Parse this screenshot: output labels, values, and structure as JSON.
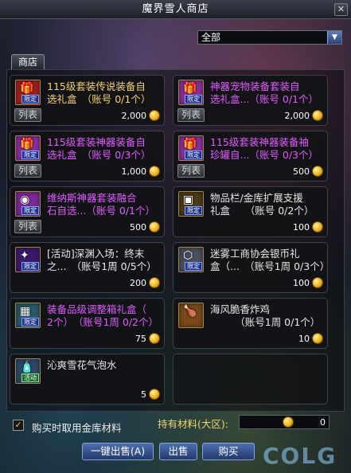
{
  "window": {
    "title": "魔界雪人商店",
    "close_glyph": "✕"
  },
  "category": {
    "selected": "全部",
    "dropdown_glyph": "▼"
  },
  "tab": {
    "label": "商店"
  },
  "items": [
    {
      "name": "115级套装传说装备自\n选礼盒　（账号 0/1个）",
      "price": "2,000",
      "list_label": "列表",
      "badge": "限定",
      "icon": "gift-box-icon",
      "icon_color": "#a0201e"
    },
    {
      "name": "神器宠物装备套装自\n选礼盒...（账号 0/1个）",
      "price": "2,000",
      "list_label": "列表",
      "badge": "限定",
      "icon": "gift-box-icon",
      "icon_color": "#8b2f9c"
    },
    {
      "name": "115级套装神器装备自\n选礼盒　（账号 0/3个）",
      "price": "1,000",
      "list_label": "列表",
      "badge": "限定",
      "icon": "gift-box-icon",
      "icon_color": "#8b2f9c"
    },
    {
      "name": "115级套装神器装备袖\n珍罐自...（账号 0/3个）",
      "price": "500",
      "list_label": "列表",
      "badge": "限定",
      "icon": "gift-box-icon",
      "icon_color": "#8b2f9c"
    },
    {
      "name": "维纳斯神器套装融合\n石自选...（账号 0/1个）",
      "price": "500",
      "list_label": "列表",
      "badge": "限定",
      "icon": "stone-icon",
      "icon_color": "#7a2a96"
    },
    {
      "name": "物品栏/金库扩展支援\n礼盒　　（账号 0/2个）",
      "price": "100",
      "badge": "限定",
      "icon": "chest-icon",
      "icon_color": "#4a3a1a"
    },
    {
      "name": "[活动]深渊入场：终末\n之...　（账号1周 0/5个）",
      "price": "200",
      "badge": "限定",
      "icon": "crystal-icon",
      "icon_color": "#3a1a6a"
    },
    {
      "name": "迷雾工商协会银币礼\n盒（...　（账号1周 0/3个）",
      "price": "100",
      "badge": "限定",
      "icon": "coin-box-icon",
      "icon_color": "#4a5060"
    },
    {
      "name": "装备品级调整箱礼盒（\n2个）　（账号1周 0/2个）",
      "price": "75",
      "badge": "限定",
      "icon": "box-icon",
      "icon_color": "#2a5a6a"
    },
    {
      "name": "海风脆香炸鸡\n　　　（账号1周 0/1个）",
      "price": "10",
      "badge": "",
      "icon": "food-icon",
      "icon_color": "#7a4a1a"
    },
    {
      "name": "沁爽雪花气泡水",
      "price": "5",
      "badge": "活动",
      "icon": "bottle-icon",
      "icon_color": "#2a4a6a"
    }
  ],
  "bottom": {
    "check_glyph": "✓",
    "use_vault_label": "购买时取用金库材料",
    "materials_label": "持有材料(大区):",
    "materials_value": "0"
  },
  "buttons": {
    "sell_all": "一键出售(A)",
    "sell": "出售",
    "buy": "购买"
  },
  "watermark": "COLG"
}
